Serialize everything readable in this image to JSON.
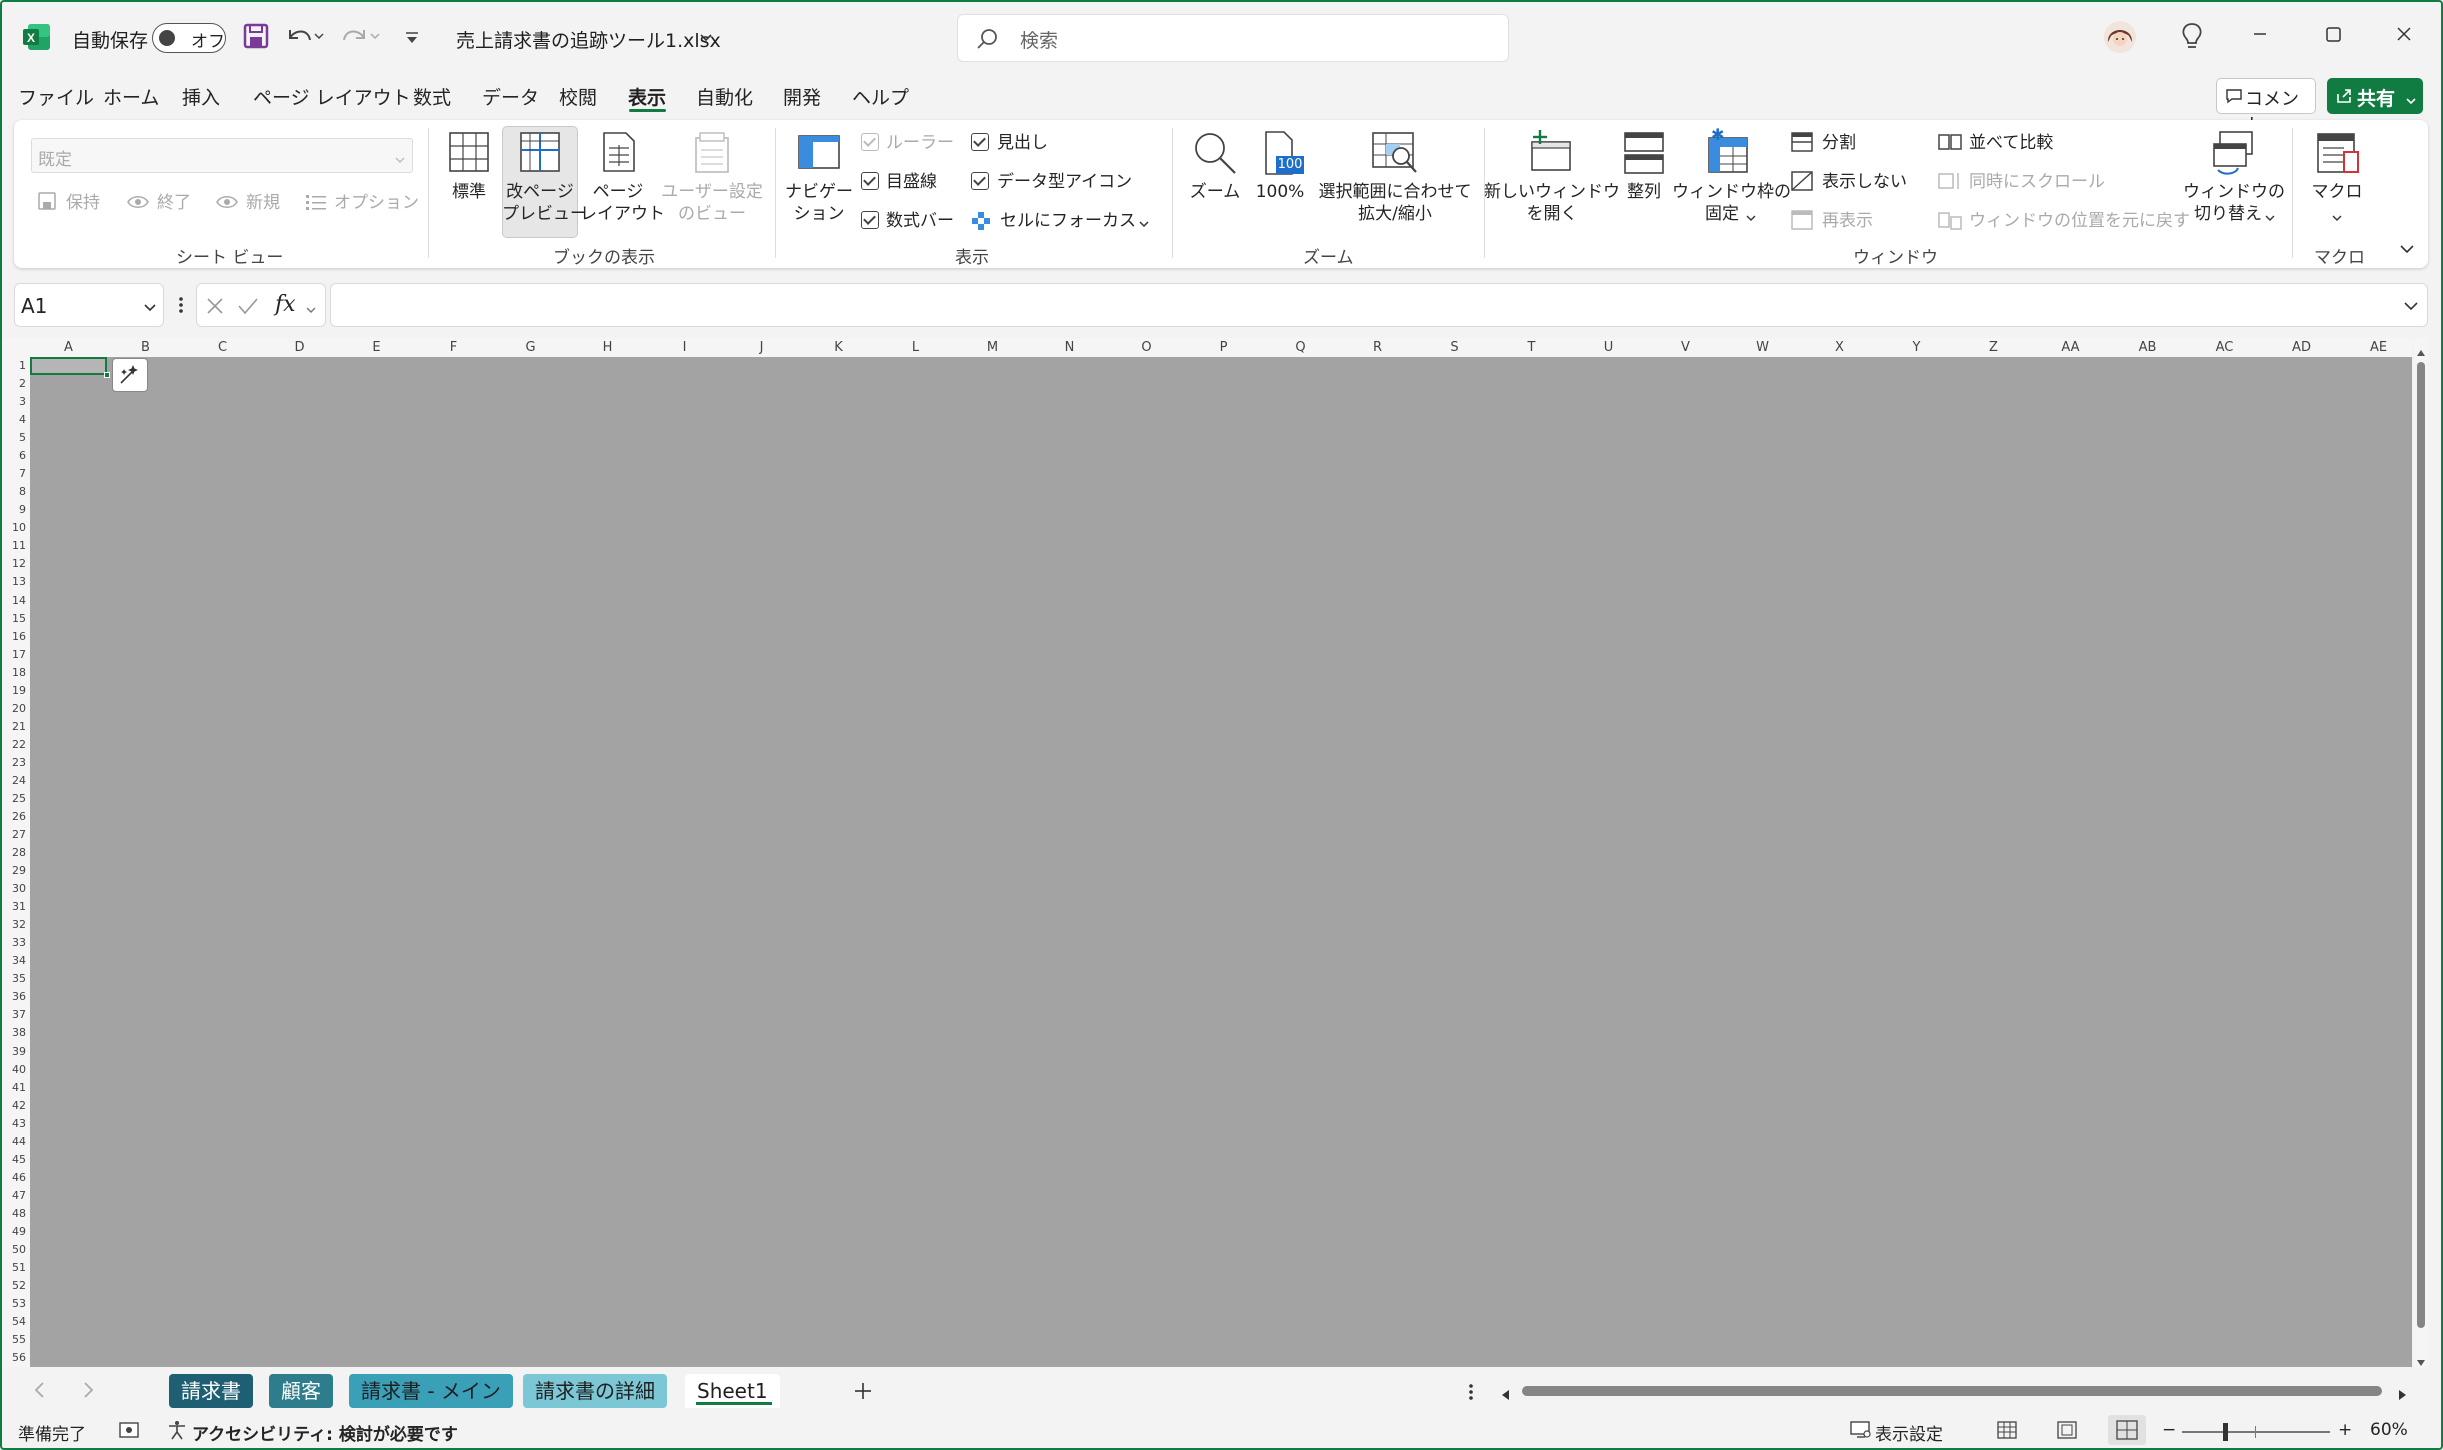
{
  "title_bar": {
    "autosave_label": "自動保存",
    "autosave_state": "オフ",
    "filename": "売上請求書の追跡ツール1.xlsx",
    "search_placeholder": "検索"
  },
  "menu": {
    "items": [
      "ファイル",
      "ホーム",
      "挿入",
      "ページ レイアウト",
      "数式",
      "データ",
      "校閲",
      "表示",
      "自動化",
      "開発",
      "ヘルプ"
    ],
    "active": "表示",
    "comment_label": "コメント",
    "share_label": "共有"
  },
  "ribbon": {
    "sheet_view": {
      "dropdown_value": "既定",
      "keep": "保持",
      "exit": "終了",
      "new": "新規",
      "options": "オプション",
      "group_label": "シート ビュー"
    },
    "workbook_views": {
      "normal": "標準",
      "page_break_line1": "改ページ",
      "page_break_line2": "プレビュー",
      "page_layout_line1": "ページ",
      "page_layout_line2": "レイアウト",
      "custom_line1": "ユーザー設定",
      "custom_line2": "のビュー",
      "group_label": "ブックの表示"
    },
    "show": {
      "navigation_line1": "ナビゲー",
      "navigation_line2": "ション",
      "ruler": "ルーラー",
      "gridlines": "目盛線",
      "formula_bar": "数式バー",
      "headings": "見出し",
      "data_type_icons": "データ型アイコン",
      "focus_cell": "セルにフォーカス",
      "group_label": "表示"
    },
    "zoom": {
      "zoom": "ズーム",
      "hundred": "100%",
      "hundred_icon": "100",
      "zoom_selection_line1": "選択範囲に合わせて",
      "zoom_selection_line2": "拡大/縮小",
      "group_label": "ズーム"
    },
    "window": {
      "new_window_line1": "新しいウィンドウ",
      "new_window_line2": "を開く",
      "arrange": "整列",
      "freeze_line1": "ウィンドウ枠の",
      "freeze_line2": "固定",
      "split": "分割",
      "hide": "表示しない",
      "unhide": "再表示",
      "side_by_side": "並べて比較",
      "sync_scroll": "同時にスクロール",
      "reset_position": "ウィンドウの位置を元に戻す",
      "switch_line1": "ウィンドウの",
      "switch_line2": "切り替え",
      "group_label": "ウィンドウ"
    },
    "macros": {
      "macro": "マクロ",
      "group_label": "マクロ"
    }
  },
  "formula_bar": {
    "name_box": "A1",
    "fx": "fx",
    "value": ""
  },
  "grid": {
    "columns": [
      "A",
      "B",
      "C",
      "D",
      "E",
      "F",
      "G",
      "H",
      "I",
      "J",
      "K",
      "L",
      "M",
      "N",
      "O",
      "P",
      "Q",
      "R",
      "S",
      "T",
      "U",
      "V",
      "W",
      "X",
      "Y",
      "Z",
      "AA",
      "AB",
      "AC",
      "AD",
      "AE"
    ],
    "row_count": 56
  },
  "sheet_tabs": [
    {
      "label": "請求書",
      "color": "#1e5f74"
    },
    {
      "label": "顧客",
      "color": "#2e7d8c"
    },
    {
      "label": "請求書 - メイン",
      "color": "#3aa0b8"
    },
    {
      "label": "請求書の詳細",
      "color": "#7cc7d6"
    },
    {
      "label": "Sheet1",
      "color": "#ffffff"
    }
  ],
  "status_bar": {
    "ready": "準備完了",
    "accessibility": "アクセシビリティ: 検討が必要です",
    "display_settings": "表示設定",
    "zoom": "60%",
    "zoom_minus": "−",
    "zoom_plus": "+"
  },
  "colors": {
    "excel_green": "#107c41",
    "grid_gray": "#a3a3a3"
  }
}
